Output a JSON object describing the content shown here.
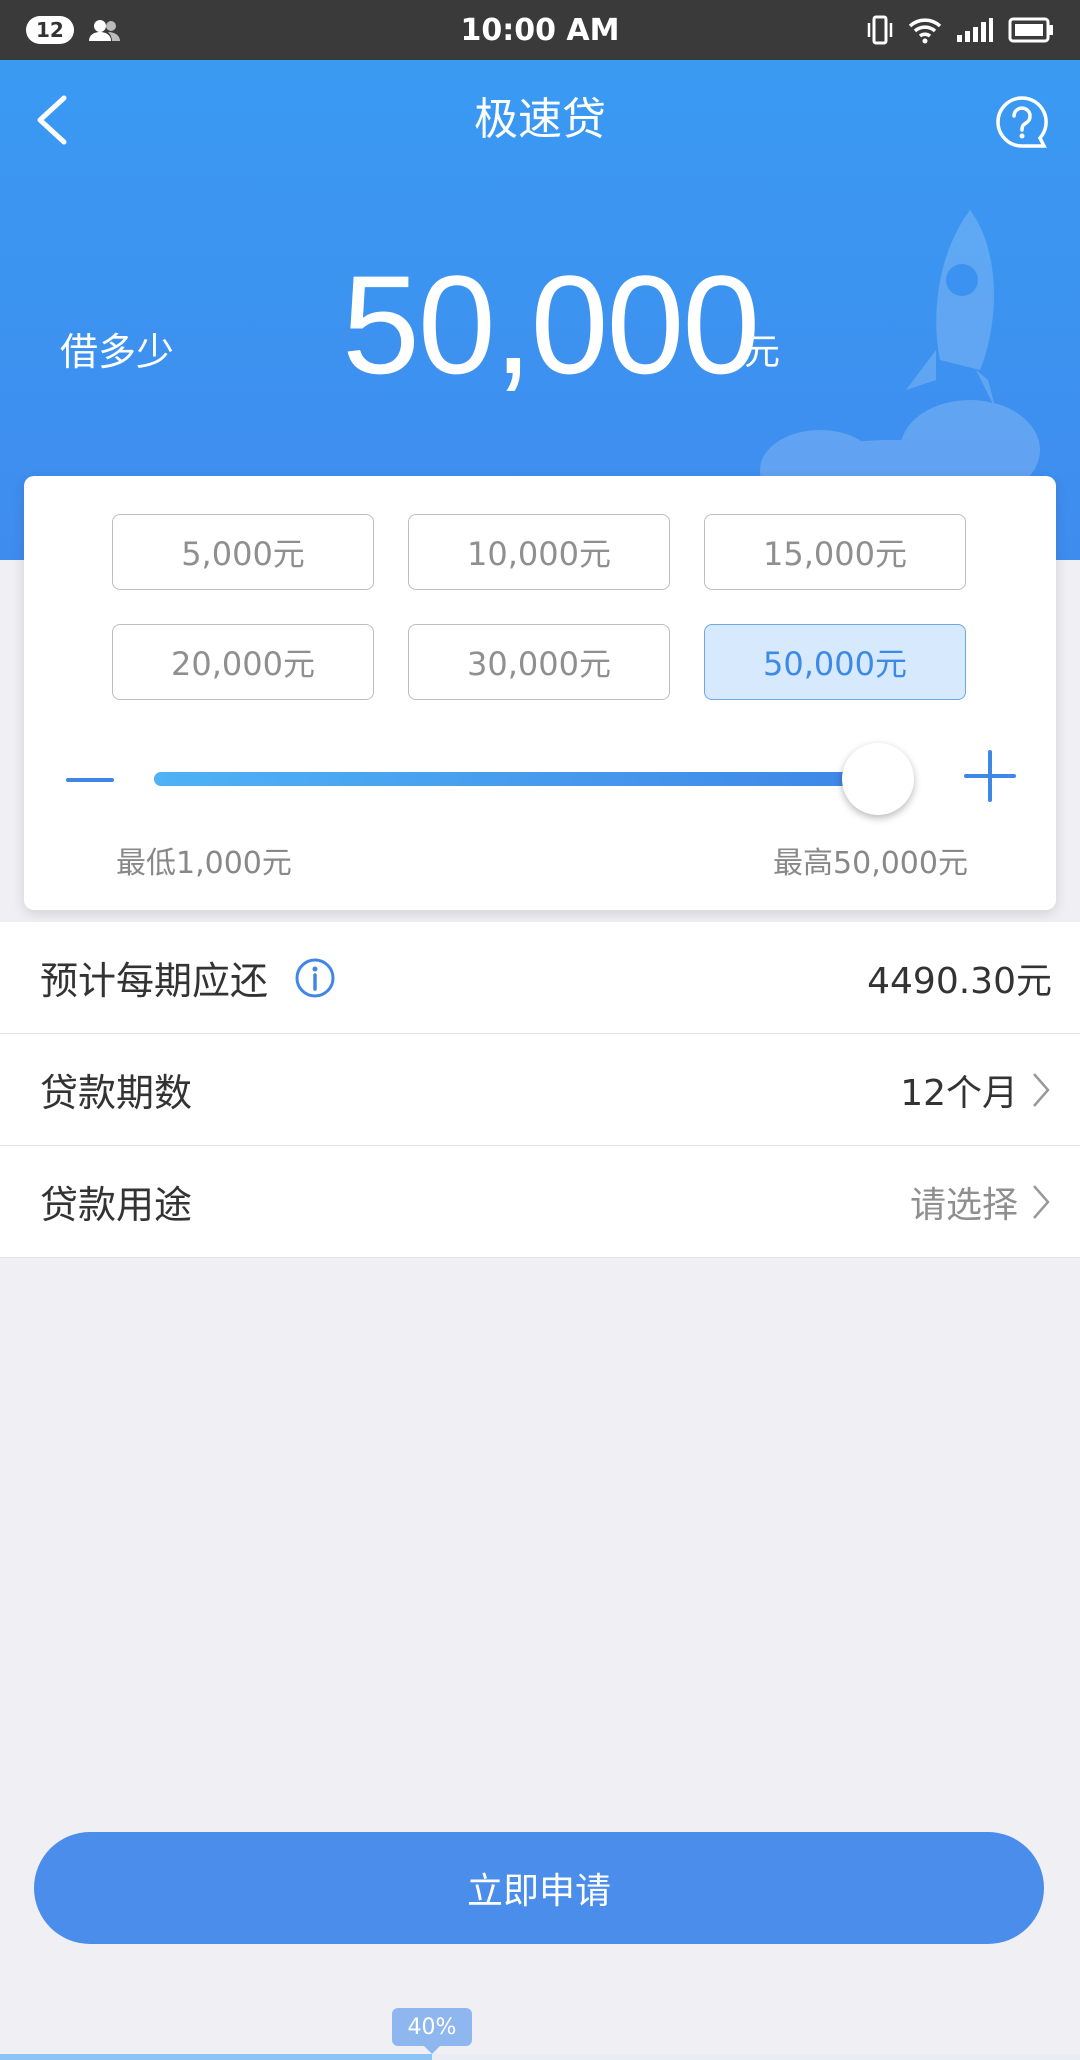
{
  "status_bar": {
    "notification_count": "12",
    "time": "10:00 AM",
    "icons": [
      "contacts-icon",
      "vibrate-icon",
      "wifi-icon",
      "signal-icon",
      "battery-icon"
    ]
  },
  "header": {
    "title": "极速贷",
    "borrow_label": "借多少",
    "amount": "50,000",
    "unit": "元",
    "back_icon": "chevron-left-icon",
    "help_icon": "question-bubble-icon"
  },
  "amount_options": [
    {
      "label": "5,000元",
      "selected": false
    },
    {
      "label": "10,000元",
      "selected": false
    },
    {
      "label": "15,000元",
      "selected": false
    },
    {
      "label": "20,000元",
      "selected": false
    },
    {
      "label": "30,000元",
      "selected": false
    },
    {
      "label": "50,000元",
      "selected": true
    }
  ],
  "slider": {
    "min": 1000,
    "max": 50000,
    "value": 50000,
    "min_label": "最低1,000元",
    "max_label": "最高50,000元"
  },
  "rows": {
    "repayment": {
      "label": "预计每期应还",
      "value": "4490.30元"
    },
    "term": {
      "label": "贷款期数",
      "value": "12个月"
    },
    "purpose": {
      "label": "贷款用途",
      "value": "请选择"
    }
  },
  "apply_button": "立即申请",
  "progress": {
    "label": "40%",
    "value": 0.4
  },
  "colors": {
    "primary": "#3f8cef",
    "selected_bg": "#d7e9fc",
    "selected_text": "#3d8ae6"
  }
}
